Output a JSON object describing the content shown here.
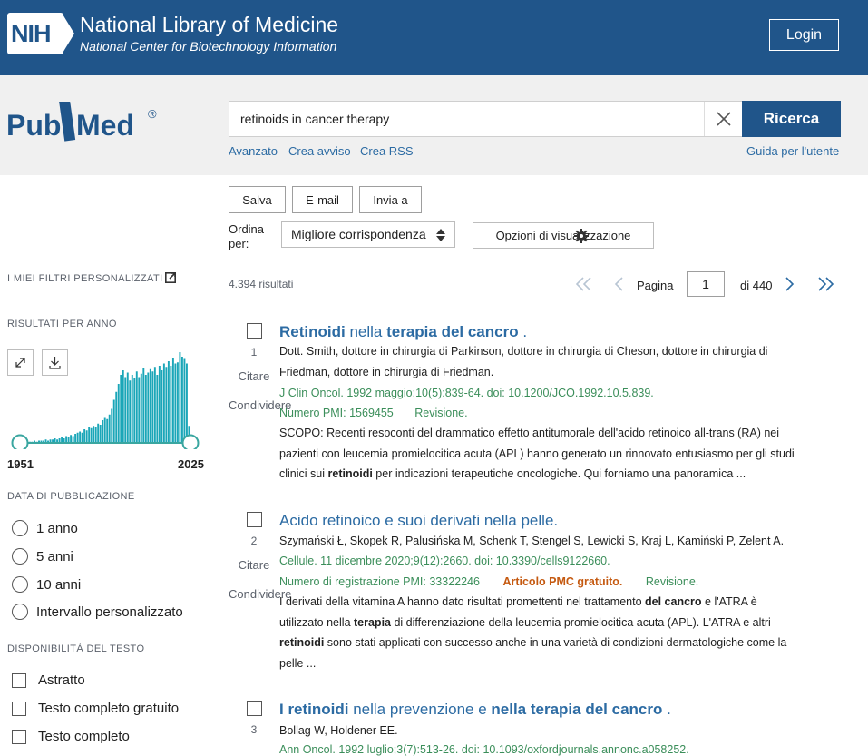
{
  "header": {
    "logo_text": "NIH",
    "title": "National Library of Medicine",
    "subtitle": "National Center for Biotechnology Information",
    "login_label": "Login"
  },
  "search": {
    "logo": "PubMed",
    "query": "retinoids in cancer therapy",
    "button_label": "Ricerca",
    "links": [
      "Avanzato",
      "Crea avviso",
      "Crea RSS"
    ],
    "guide_link": "Guida per l'utente"
  },
  "actions": {
    "save": "Salva",
    "email": "E-mail",
    "send": "Invia a",
    "sort_label_1": "Ordina",
    "sort_label_2": "per:",
    "sort_value": "Migliore corrispondenza",
    "display_options": "Opzioni di visualizzazione"
  },
  "sidebar": {
    "my_filters": "I MIEI FILTRI PERSONALIZZATI",
    "results_by_year": "RISULTATI PER ANNO",
    "year_start": "1951",
    "year_end": "2025",
    "pub_date_label": "DATA DI PUBBLICAZIONE",
    "pub_date_options": [
      "1 anno",
      "5 anni",
      "10 anni",
      "Intervallo personalizzato"
    ],
    "text_avail_label": "DISPONIBILITÀ DEL TESTO",
    "text_avail_options": [
      "Astratto",
      "Testo completo gratuito",
      "Testo completo"
    ]
  },
  "results_bar": {
    "count": "4.394 risultati",
    "page_label": "Pagina",
    "page_value": "1",
    "page_total": "di 440"
  },
  "result_labels": {
    "cite": "Citare",
    "share": "Condividere"
  },
  "results": [
    {
      "num": "1",
      "title_parts": [
        {
          "t": "Retinoidi",
          "b": true
        },
        {
          "t": " nella ",
          "b": false
        },
        {
          "t": "terapia del cancro",
          "b": true
        },
        {
          "t": " .",
          "b": false
        }
      ],
      "authors_1": "Dott. Smith, dottore in chirurgia di Parkinson, dottore in chirurgia di Cheson, dottore in chirurgia di",
      "authors_2": "Friedman, dottore in chirurgia di Friedman.",
      "journal": "J Clin Oncol. 1992 maggio;10(5):839-64. doi: 10.1200/JCO.1992.10.5.839.",
      "pmid": "Numero PMI: 1569455",
      "pmc": "",
      "type": "Revisione.",
      "snippet": [
        [
          {
            "t": "SCOPO: Recenti resoconti del drammatico effetto antitumorale dell'acido retinoico all-trans (RA) nei",
            "b": false
          }
        ],
        [
          {
            "t": "pazienti con leucemia promielocitica acuta (APL) hanno generato un rinnovato entusiasmo per gli studi",
            "b": false
          }
        ],
        [
          {
            "t": "clinici sui ",
            "b": false
          },
          {
            "t": "retinoidi",
            "b": true
          },
          {
            "t": " per indicazioni terapeutiche oncologiche. Qui forniamo una panoramica ...",
            "b": false
          }
        ]
      ]
    },
    {
      "num": "2",
      "title_parts": [
        {
          "t": "Acido retinoico e suoi derivati nella pelle.",
          "b": false
        }
      ],
      "authors_1": "Szymański Ł, Skopek R, Palusińska M, Schenk T, Stengel S, Lewicki S, Kraj L, Kamiński P, Zelent A.",
      "authors_2": "",
      "journal": "Cellule. 11 dicembre 2020;9(12):2660. doi: 10.3390/cells9122660.",
      "pmid": "Numero di registrazione PMI: 33322246",
      "pmc": "Articolo PMC gratuito.",
      "type": "Revisione.",
      "snippet": [
        [
          {
            "t": "I derivati della vitamina A hanno dato risultati promettenti nel trattamento ",
            "b": false
          },
          {
            "t": "del cancro",
            "b": true
          },
          {
            "t": " e l'ATRA è",
            "b": false
          }
        ],
        [
          {
            "t": "utilizzato nella ",
            "b": false
          },
          {
            "t": "terapia",
            "b": true
          },
          {
            "t": " di differenziazione della leucemia promielocitica acuta (APL). L'ATRA e altri",
            "b": false
          }
        ],
        [
          {
            "t": "retinoidi",
            "b": true
          },
          {
            "t": " sono stati applicati con successo anche in una varietà di condizioni dermatologiche come la",
            "b": false
          }
        ],
        [
          {
            "t": "pelle ...",
            "b": false
          }
        ]
      ]
    },
    {
      "num": "3",
      "title_parts": [
        {
          "t": "I retinoidi",
          "b": true
        },
        {
          "t": " nella prevenzione e ",
          "b": false
        },
        {
          "t": "nella terapia del cancro",
          "b": true
        },
        {
          "t": " .",
          "b": false
        }
      ],
      "authors_1": "Bollag W, Holdener EE.",
      "authors_2": "",
      "journal": "Ann Oncol. 1992 luglio;3(7):513-26. doi: 10.1093/oxfordjournals.annonc.a058252.",
      "pmid": "",
      "pmc": "",
      "type": "",
      "snippet": []
    }
  ],
  "histogram_counts": [
    1,
    1,
    1,
    1,
    1,
    1,
    2,
    1,
    2,
    2,
    2,
    3,
    2,
    3,
    3,
    4,
    3,
    4,
    5,
    4,
    6,
    5,
    7,
    6,
    8,
    9,
    10,
    9,
    12,
    11,
    14,
    13,
    15,
    14,
    17,
    16,
    20,
    22,
    21,
    25,
    30,
    38,
    45,
    52,
    60,
    64,
    58,
    62,
    55,
    60,
    57,
    63,
    58,
    61,
    66,
    60,
    62,
    65,
    63,
    67,
    60,
    68,
    64,
    70,
    67,
    72,
    68,
    75,
    70,
    71,
    80,
    76,
    74,
    70,
    15
  ],
  "colors": {
    "brand_blue": "#20558a",
    "link_blue": "#2c6ba3",
    "bar_teal": "#1aa6b8",
    "green_meta": "#3b8e5a",
    "pmc_orange": "#c55a11"
  }
}
